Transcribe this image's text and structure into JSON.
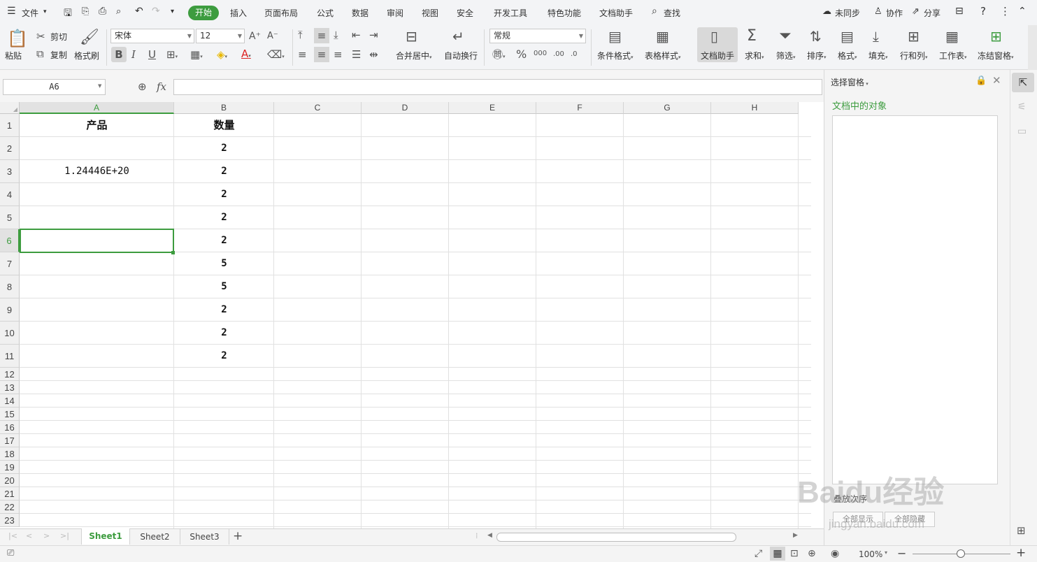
{
  "menubar": {
    "file": "文件",
    "tabs": [
      "开始",
      "插入",
      "页面布局",
      "公式",
      "数据",
      "审阅",
      "视图",
      "安全",
      "开发工具",
      "特色功能",
      "文档助手"
    ],
    "search": "查找",
    "sync": "未同步",
    "collab": "协作",
    "share": "分享"
  },
  "ribbon": {
    "paste": "粘贴",
    "cut": "剪切",
    "copy": "复制",
    "format_painter": "格式刷",
    "font_name": "宋体",
    "font_size": "12",
    "merge_center": "合并居中",
    "wrap_text": "自动换行",
    "number_format": "常规",
    "cond_format": "条件格式",
    "table_style": "表格样式",
    "doc_assistant": "文档助手",
    "sum": "求和",
    "filter": "筛选",
    "sort": "排序",
    "format": "格式",
    "fill": "填充",
    "row_col": "行和列",
    "worksheet": "工作表",
    "freeze": "冻结窗格"
  },
  "formula": {
    "cell_ref": "A6",
    "fx": "fx"
  },
  "grid": {
    "columns": [
      "A",
      "B",
      "C",
      "D",
      "E",
      "F",
      "G",
      "H"
    ],
    "rows": [
      "1",
      "2",
      "3",
      "4",
      "5",
      "6",
      "7",
      "8",
      "9",
      "10",
      "11",
      "12",
      "13",
      "14",
      "15",
      "16",
      "17",
      "18",
      "19",
      "20",
      "21",
      "22",
      "23"
    ],
    "cells": {
      "A1": "产品",
      "B1": "数量",
      "A3": "1.24446E+20",
      "B2": "2",
      "B3": "2",
      "B4": "2",
      "B5": "2",
      "B6": "2",
      "B7": "5",
      "B8": "5",
      "B9": "2",
      "B10": "2",
      "B11": "2"
    },
    "accent": "#3d9c3f"
  },
  "taskpane": {
    "title": "选择窗格",
    "subtitle": "文档中的对象",
    "order": "叠放次序",
    "show_all": "全部显示",
    "hide_all": "全部隐藏"
  },
  "sheets": {
    "tabs": [
      "Sheet1",
      "Sheet2",
      "Sheet3"
    ],
    "active": "Sheet1"
  },
  "status": {
    "zoom": "100%"
  },
  "watermark": {
    "brand": "Baidu经验",
    "url": "jingyan.baidu.com"
  }
}
